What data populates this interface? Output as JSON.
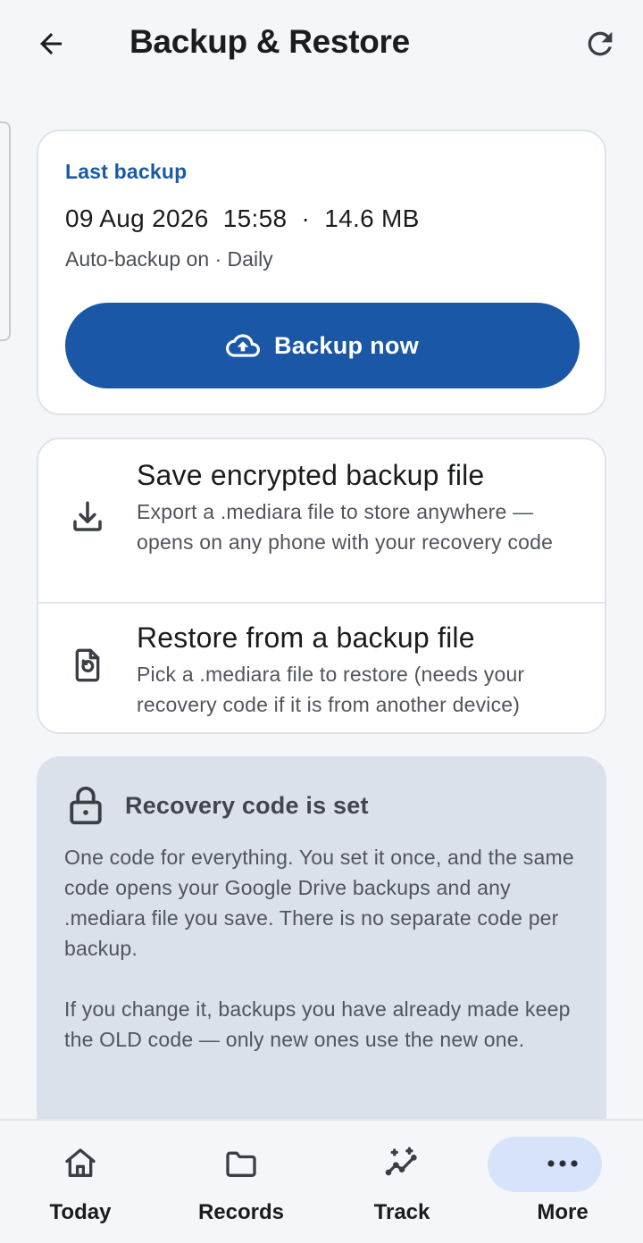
{
  "header": {
    "title": "Backup & Restore"
  },
  "last_backup": {
    "label": "Last backup",
    "date": "09 Aug 2026",
    "time": "15:58",
    "size": "14.6 MB",
    "auto": "Auto-backup on · Daily",
    "button_label": "Backup now"
  },
  "options": [
    {
      "title": "Save encrypted backup file",
      "description": "Export a .mediara file to store anywhere — opens on any phone with your recovery code",
      "icon": "download-icon"
    },
    {
      "title": "Restore from a backup file",
      "description": "Pick a .mediara file to restore (needs your recovery code if it is from another device)",
      "icon": "restore-file-icon"
    }
  ],
  "recovery": {
    "title": "Recovery code is set",
    "paragraph1": "One code for everything. You set it once, and the same code opens your Google Drive backups and any .mediara file you save. There is no separate code per backup.",
    "paragraph2": "If you change it, backups you have already made keep the OLD code — only new ones use the new one."
  },
  "nav": [
    {
      "label": "Today",
      "icon": "home-icon"
    },
    {
      "label": "Records",
      "icon": "folder-icon"
    },
    {
      "label": "Track",
      "icon": "track-icon"
    },
    {
      "label": "More",
      "icon": "more-icon",
      "active": true
    }
  ],
  "colors": {
    "accent": "#1a57a6",
    "accent_text": "#1a5aa6",
    "recovery_bg": "#dae1eb",
    "active_pill": "#d6e3fa"
  }
}
